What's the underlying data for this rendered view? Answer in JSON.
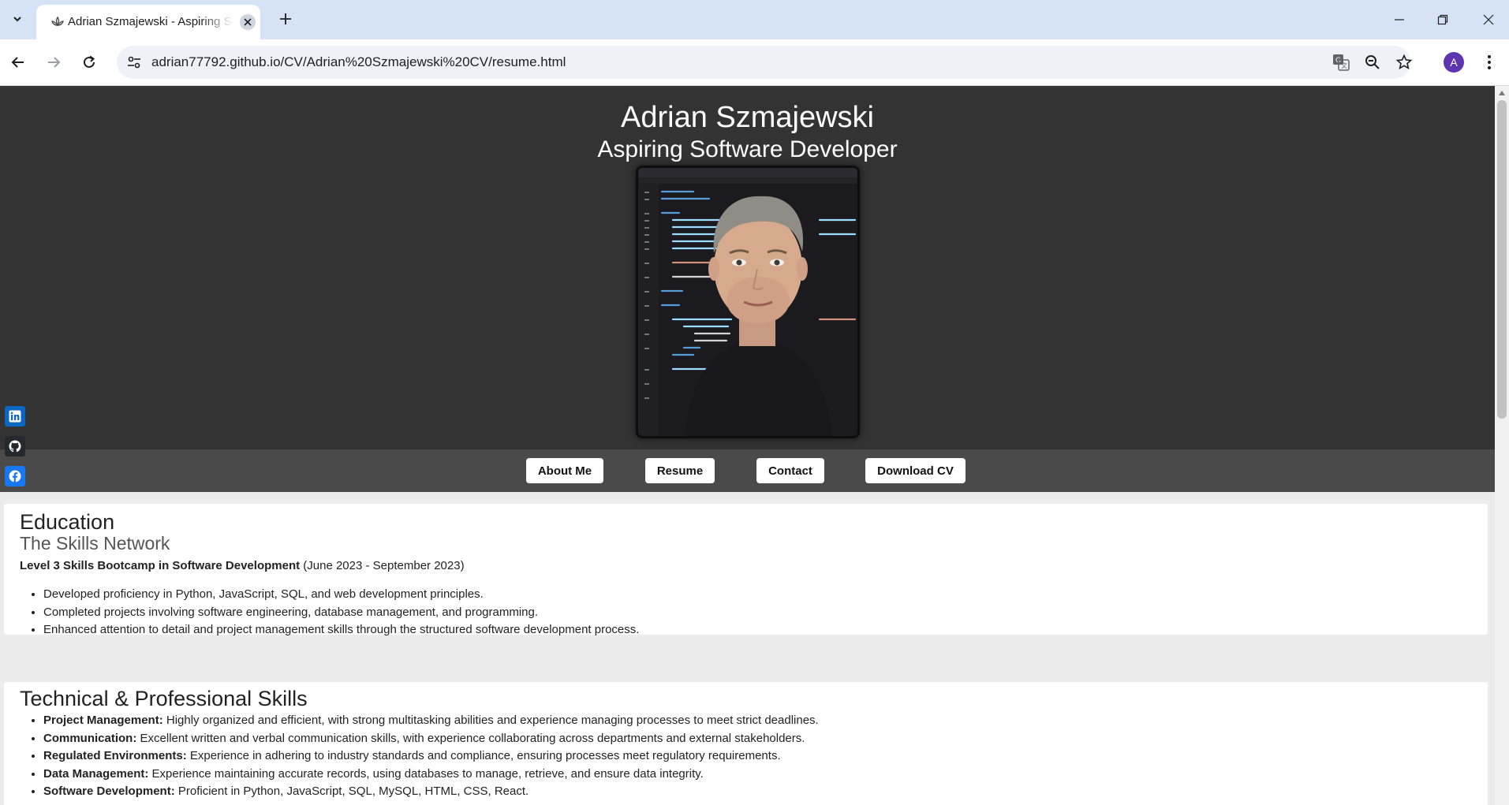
{
  "browser": {
    "tab_title": "Adrian Szmajewski - Aspiring Software Developer",
    "url": "adrian77792.github.io/CV/Adrian%20Szmajewski%20CV/resume.html",
    "avatar_letter": "A"
  },
  "hero": {
    "name": "Adrian Szmajewski",
    "role": "Aspiring Software Developer"
  },
  "nav": {
    "about": "About Me",
    "resume": "Resume",
    "contact": "Contact",
    "download": "Download CV"
  },
  "social": {
    "colors": {
      "linkedin": "#0a66c2",
      "github": "#24292e",
      "facebook": "#1877f2"
    }
  },
  "education": {
    "title": "Education",
    "school": "The Skills Network",
    "course": "Level 3 Skills Bootcamp in Software Development",
    "dates": " (June 2023 - September 2023)",
    "items": [
      "Developed proficiency in Python, JavaScript, SQL, and web development principles.",
      "Completed projects involving software engineering, database management, and programming.",
      "Enhanced attention to detail and project management skills through the structured software development process."
    ]
  },
  "skills": {
    "title": "Technical & Professional Skills",
    "items": [
      {
        "label": "Project Management:",
        "text": " Highly organized and efficient, with strong multitasking abilities and experience managing processes to meet strict deadlines."
      },
      {
        "label": "Communication:",
        "text": " Excellent written and verbal communication skills, with experience collaborating across departments and external stakeholders."
      },
      {
        "label": "Regulated Environments:",
        "text": " Experience in adhering to industry standards and compliance, ensuring processes meet regulatory requirements."
      },
      {
        "label": "Data Management:",
        "text": " Experience maintaining accurate records, using databases to manage, retrieve, and ensure data integrity."
      },
      {
        "label": "Software Development:",
        "text": " Proficient in Python, JavaScript, SQL, MySQL, HTML, CSS, React."
      }
    ]
  }
}
